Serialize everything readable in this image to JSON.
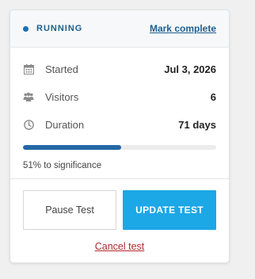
{
  "header": {
    "status_label": "RUNNING",
    "mark_complete_label": "Mark complete"
  },
  "stats": [
    {
      "icon": "calendar-icon",
      "label": "Started",
      "value": "Jul 3, 2026"
    },
    {
      "icon": "visitors-icon",
      "label": "Visitors",
      "value": "6"
    },
    {
      "icon": "clock-icon",
      "label": "Duration",
      "value": "71 days"
    }
  ],
  "progress": {
    "percent": 51,
    "text": "51% to significance"
  },
  "actions": {
    "pause_label": "Pause Test",
    "update_label": "UPDATE TEST",
    "cancel_label": "Cancel test"
  },
  "colors": {
    "accent": "#1f5f8f",
    "primary_button": "#1ca7e6",
    "progress_fill": "#2468a6",
    "cancel": "#b02a2a"
  }
}
